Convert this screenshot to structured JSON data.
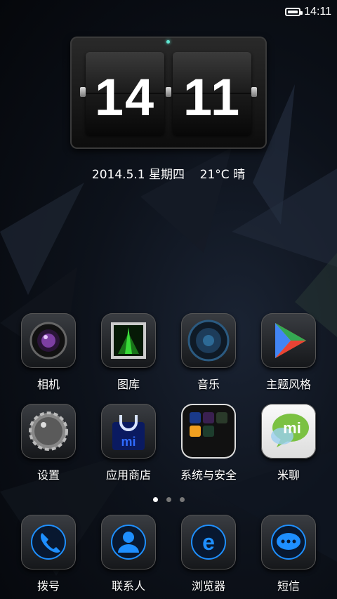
{
  "status": {
    "time": "14:11",
    "battery_level": 0.9
  },
  "clock": {
    "hours": "14",
    "minutes": "11"
  },
  "date_weather": {
    "date": "2014.5.1",
    "weekday": "星期四",
    "temperature": "21°C",
    "condition": "晴"
  },
  "apps_row1": [
    {
      "label": "相机",
      "icon": "camera-icon"
    },
    {
      "label": "图库",
      "icon": "gallery-icon"
    },
    {
      "label": "音乐",
      "icon": "music-speaker-icon"
    },
    {
      "label": "主题风格",
      "icon": "theme-play-icon"
    }
  ],
  "apps_row2": [
    {
      "label": "设置",
      "icon": "settings-knob-icon"
    },
    {
      "label": "应用商店",
      "icon": "app-store-bag-icon"
    },
    {
      "label": "系统与安全",
      "icon": "folder-icon"
    },
    {
      "label": "米聊",
      "icon": "miliao-chat-icon"
    }
  ],
  "page_indicator": {
    "count": 3,
    "active": 0
  },
  "dock": [
    {
      "label": "拨号",
      "icon": "phone-icon"
    },
    {
      "label": "联系人",
      "icon": "contacts-icon"
    },
    {
      "label": "浏览器",
      "icon": "browser-icon"
    },
    {
      "label": "短信",
      "icon": "message-icon"
    }
  ],
  "colors": {
    "accent_blue": "#1e8fff",
    "clock_led": "#5fe6d2",
    "mi_green": "#7bc142"
  }
}
